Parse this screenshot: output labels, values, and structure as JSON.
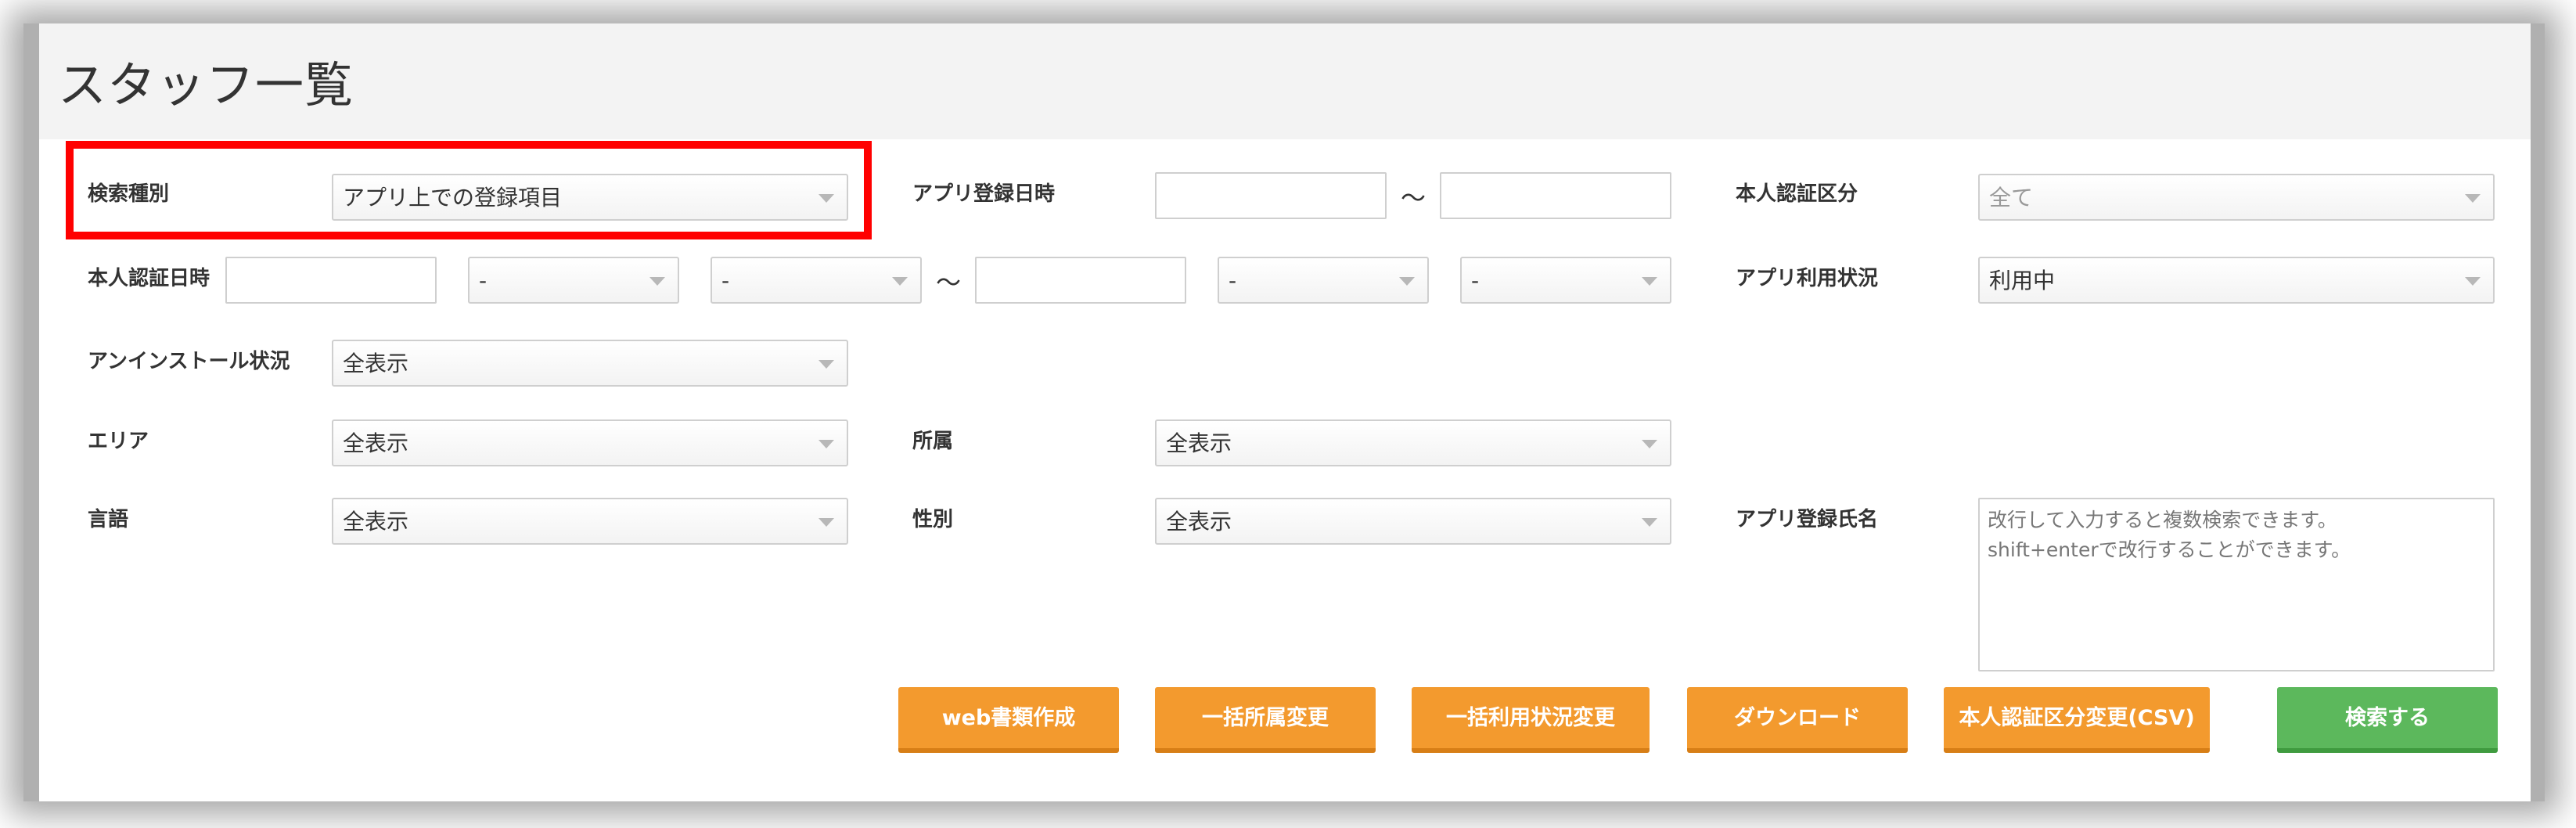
{
  "page_title": "スタッフ一覧",
  "fields": {
    "search_type": {
      "label": "検索種別",
      "value": "アプリ上での登録項目"
    },
    "app_registration_datetime": {
      "label": "アプリ登録日時",
      "from": "",
      "to": "",
      "separator": "～"
    },
    "identity_verification_category": {
      "label": "本人認証区分",
      "value": "全て"
    },
    "identity_verification_datetime": {
      "label": "本人認証日時",
      "from_date": "",
      "from_hour": "-",
      "from_minute": "-",
      "separator": "～",
      "to_date": "",
      "to_hour": "-",
      "to_minute": "-"
    },
    "app_usage_status": {
      "label": "アプリ利用状況",
      "value": "利用中"
    },
    "uninstall_status": {
      "label": "アンインストール状況",
      "value": "全表示"
    },
    "area": {
      "label": "エリア",
      "value": "全表示"
    },
    "affiliation": {
      "label": "所属",
      "value": "全表示"
    },
    "language": {
      "label": "言語",
      "value": "全表示"
    },
    "gender": {
      "label": "性別",
      "value": "全表示"
    },
    "app_registered_name": {
      "label": "アプリ登録氏名",
      "placeholder_line1": "改行して入力すると複数検索できます。",
      "placeholder_line2": "shift+enterで改行することができます。"
    }
  },
  "buttons": {
    "web_document": "web書類作成",
    "bulk_affiliation_change": "一括所属変更",
    "bulk_usage_status_change": "一括利用状況変更",
    "download": "ダウンロード",
    "verification_category_change_csv": "本人認証区分変更(CSV)",
    "search": "検索する"
  },
  "colors": {
    "orange_button": "#f39a2e",
    "green_button": "#5cb85c",
    "highlight": "#ff0000"
  }
}
